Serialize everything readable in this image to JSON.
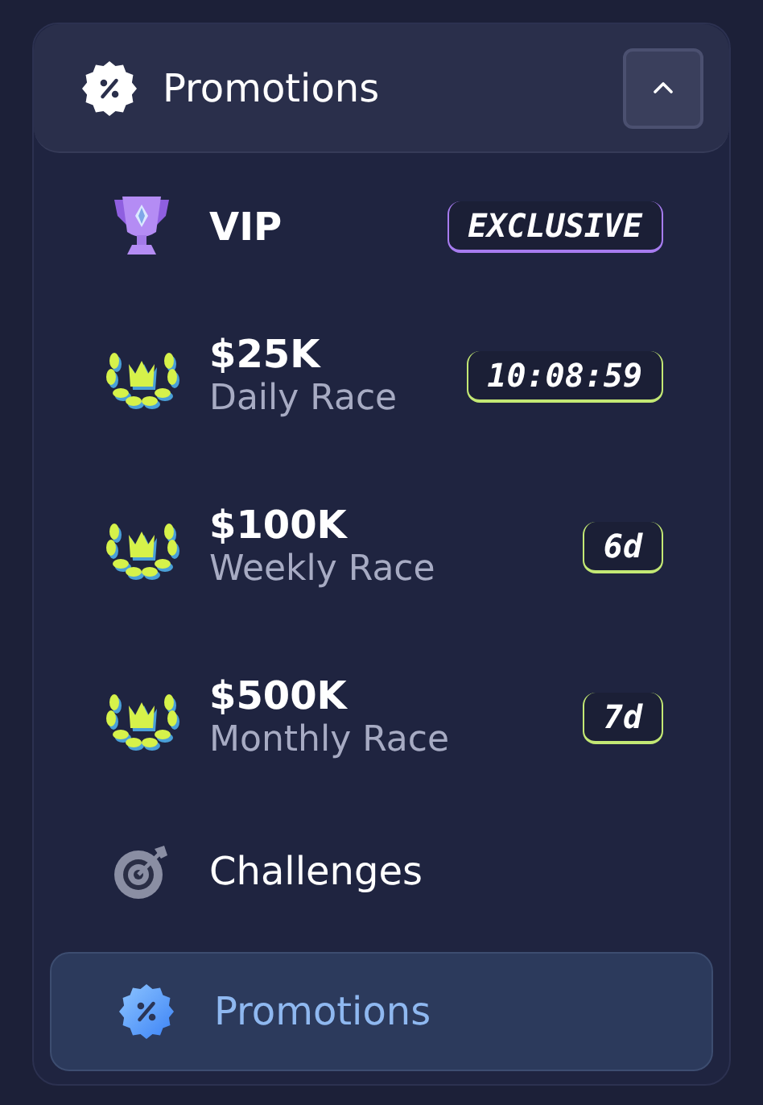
{
  "header": {
    "title": "Promotions",
    "expanded": true
  },
  "items": [
    {
      "kind": "vip",
      "title": "VIP",
      "badge": "EXCLUSIVE",
      "color": "#a77cf0",
      "selected": false
    },
    {
      "kind": "race",
      "title": "$25K",
      "subtitle": "Daily Race",
      "badge": "10:08:59",
      "color": "#c3e874",
      "selected": false
    },
    {
      "kind": "race",
      "title": "$100K",
      "subtitle": "Weekly Race",
      "badge": "6d",
      "color": "#c3e874",
      "selected": false
    },
    {
      "kind": "race",
      "title": "$500K",
      "subtitle": "Monthly Race",
      "badge": "7d",
      "color": "#c3e874",
      "selected": false
    },
    {
      "kind": "challenges",
      "title": "Challenges",
      "selected": false
    },
    {
      "kind": "promotions",
      "title": "Promotions",
      "selected": true
    }
  ]
}
